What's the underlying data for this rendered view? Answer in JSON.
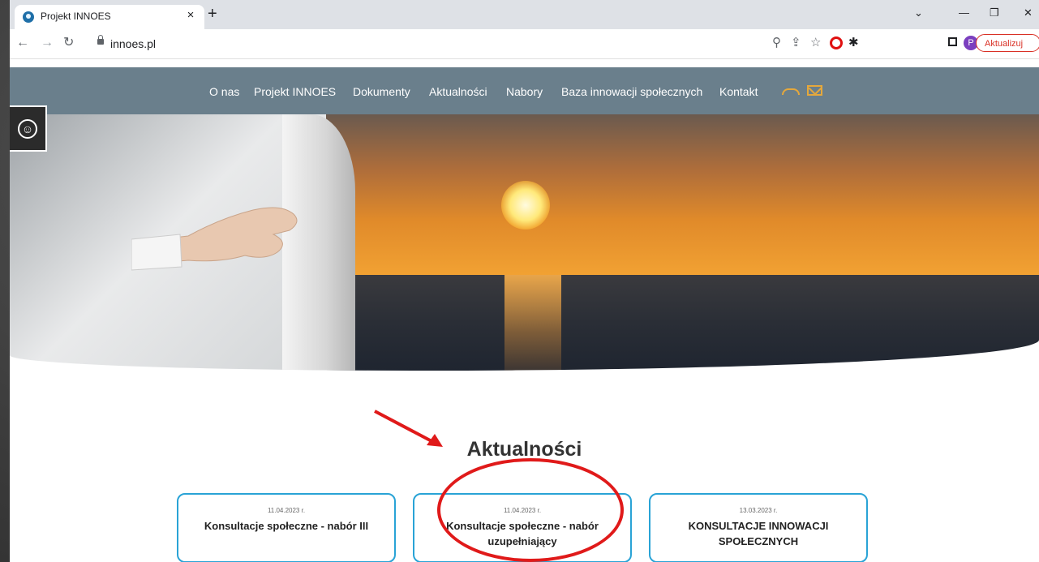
{
  "browser": {
    "tab_title": "Projekt INNOES",
    "tab_close": "×",
    "new_tab": "+",
    "url": "innoes.pl",
    "update_button": "Aktualizuj",
    "profile_initial": "P",
    "window_controls": {
      "minimize": "—",
      "restore": "❐",
      "close": "✕",
      "tab_search": "⌄"
    }
  },
  "site_nav": {
    "links": [
      "O nas",
      "Projekt INNOES",
      "Dokumenty",
      "Aktualności",
      "Nabory",
      "Baza innowacji społecznych",
      "Kontakt"
    ],
    "accent_color": "#e5a83c",
    "bg_color": "#6a7f8c"
  },
  "section": {
    "title": "Aktualności"
  },
  "news_cards": [
    {
      "date": "11.04.2023 r.",
      "title": "Konsultacje społeczne - nabór III"
    },
    {
      "date": "11.04.2023 r.",
      "title": "Konsultacje społeczne - nabór uzupełniający"
    },
    {
      "date": "13.03.2023 r.",
      "title": "KONSULTACJE INNOWACJI SPOŁECZNYCH"
    }
  ],
  "annotation_color": "#e01a1a",
  "card_border_color": "#29a3d6"
}
